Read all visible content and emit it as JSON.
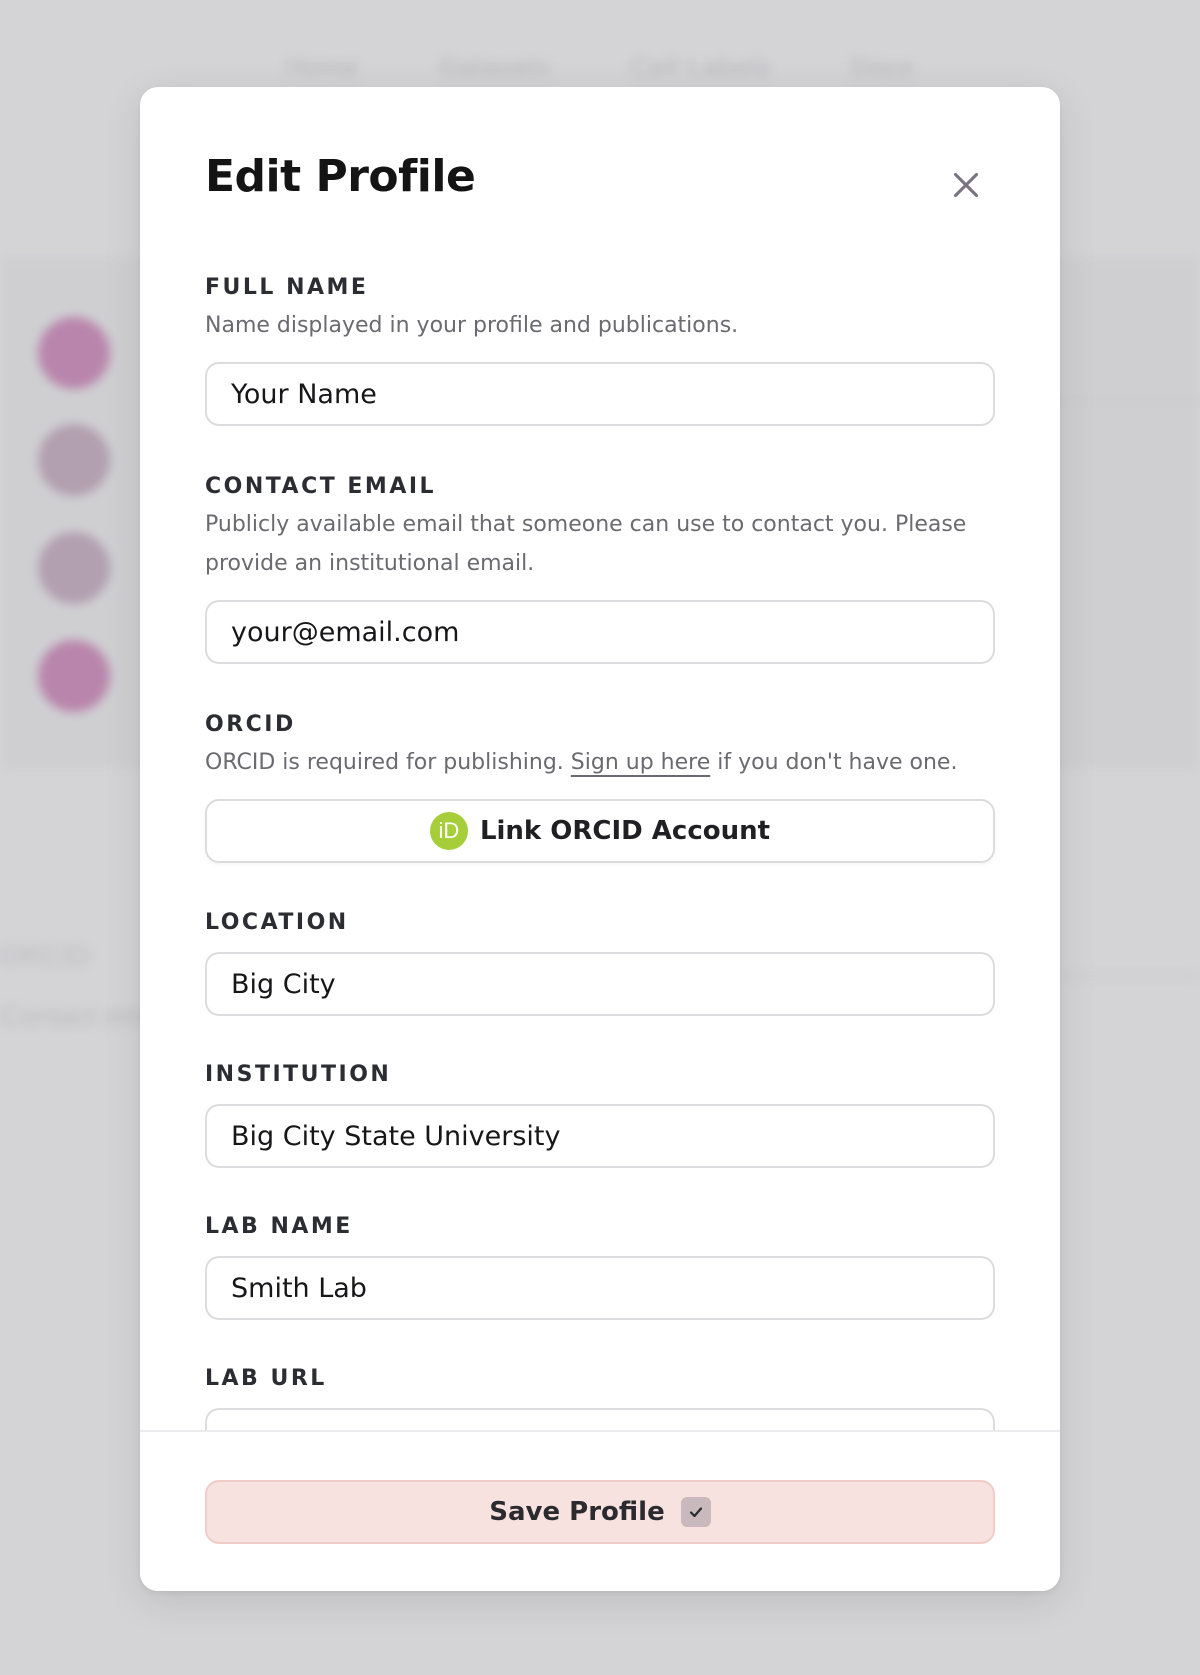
{
  "background": {
    "nav": [
      "Home",
      "Datasets",
      "Cell Labels",
      "Docs"
    ],
    "labels": [
      "ORCID",
      "Contact email"
    ]
  },
  "modal": {
    "title": "Edit Profile",
    "close_icon": "close-icon"
  },
  "fields": {
    "full_name": {
      "label": "FULL NAME",
      "description": "Name displayed in your profile and publications.",
      "placeholder": "Your Name"
    },
    "contact_email": {
      "label": "CONTACT EMAIL",
      "description": "Publicly available email that someone can use to contact you. Please provide an institutional email.",
      "placeholder": "your@email.com"
    },
    "orcid": {
      "label": "ORCID",
      "description_before": "ORCID is required for publishing. ",
      "link_text": "Sign up here",
      "description_after": " if you don't have one.",
      "button_label": "Link ORCID Account",
      "icon_text": "iD",
      "icon_color": "#a6ce39"
    },
    "location": {
      "label": "LOCATION",
      "placeholder": "Big City"
    },
    "institution": {
      "label": "INSTITUTION",
      "placeholder": "Big City State University"
    },
    "lab_name": {
      "label": "LAB NAME",
      "placeholder": "Smith Lab"
    },
    "lab_url": {
      "label": "LAB URL",
      "placeholder": ""
    }
  },
  "footer": {
    "save_label": "Save Profile",
    "save_icon": "check-icon",
    "save_bg_color": "#f7e2e0"
  }
}
